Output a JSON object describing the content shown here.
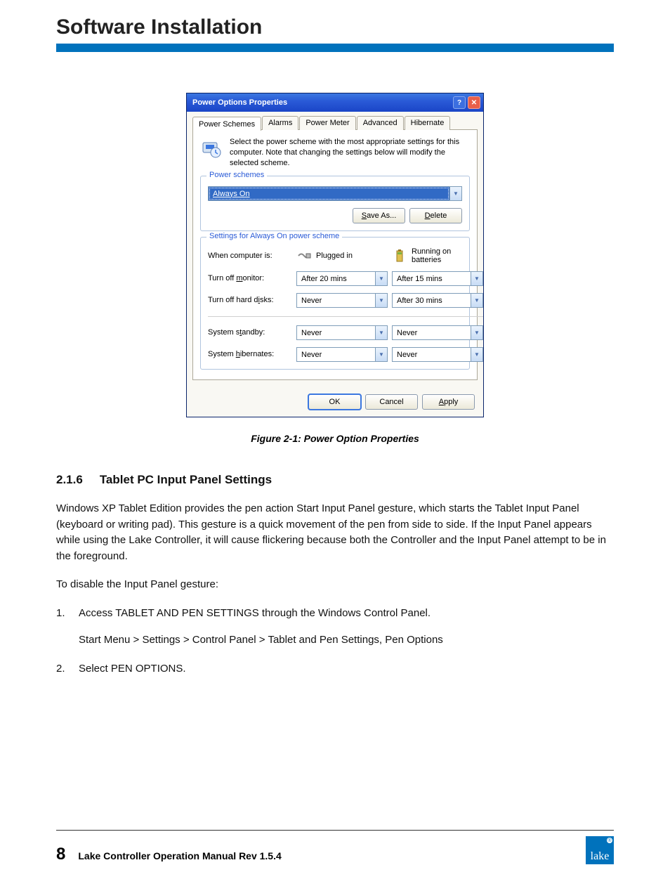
{
  "header": {
    "title": "Software Installation"
  },
  "dialog": {
    "title": "Power Options Properties",
    "tabs": [
      "Power Schemes",
      "Alarms",
      "Power Meter",
      "Advanced",
      "Hibernate"
    ],
    "intro": "Select the power scheme with the most appropriate settings for this computer. Note that changing the settings below will modify the selected scheme.",
    "schemes_legend": "Power schemes",
    "scheme_selected": "Always On",
    "save_as": "Save As...",
    "delete": "Delete",
    "settings_legend": "Settings for Always On power scheme",
    "row_labels": {
      "when": "When computer is:",
      "monitor": "Turn off monitor:",
      "disks": "Turn off hard disks:",
      "standby": "System standby:",
      "hibernates": "System hibernates:"
    },
    "plugged": "Plugged in",
    "batteries_l1": "Running on",
    "batteries_l2": "batteries",
    "vals": {
      "monitor_plug": "After 20 mins",
      "monitor_bat": "After 15 mins",
      "disk_plug": "Never",
      "disk_bat": "After 30 mins",
      "standby_plug": "Never",
      "standby_bat": "Never",
      "hib_plug": "Never",
      "hib_bat": "Never"
    },
    "ok": "OK",
    "cancel": "Cancel",
    "apply": "Apply"
  },
  "figure_caption": "Figure 2-1: Power Option Properties",
  "section": {
    "num": "2.1.6",
    "title": "Tablet PC Input Panel Settings",
    "p1": "Windows XP Tablet Edition provides the pen action Start Input Panel gesture, which starts the Tablet Input Panel (keyboard or writing pad). This gesture is a quick movement of the pen from side to side. If the Input Panel appears while using the Lake Controller, it will cause flickering because both the Controller and the Input Panel attempt to be in the foreground.",
    "p2": "To disable the Input Panel gesture:",
    "steps": [
      "Access TABLET AND PEN SETTINGS through the Windows Control Panel.",
      "Select PEN OPTIONS."
    ],
    "step1_sub": "Start Menu > Settings > Control Panel > Tablet and Pen Settings, Pen Options"
  },
  "footer": {
    "page": "8",
    "title": "Lake Controller Operation Manual Rev 1.5.4",
    "logo": "lake"
  }
}
